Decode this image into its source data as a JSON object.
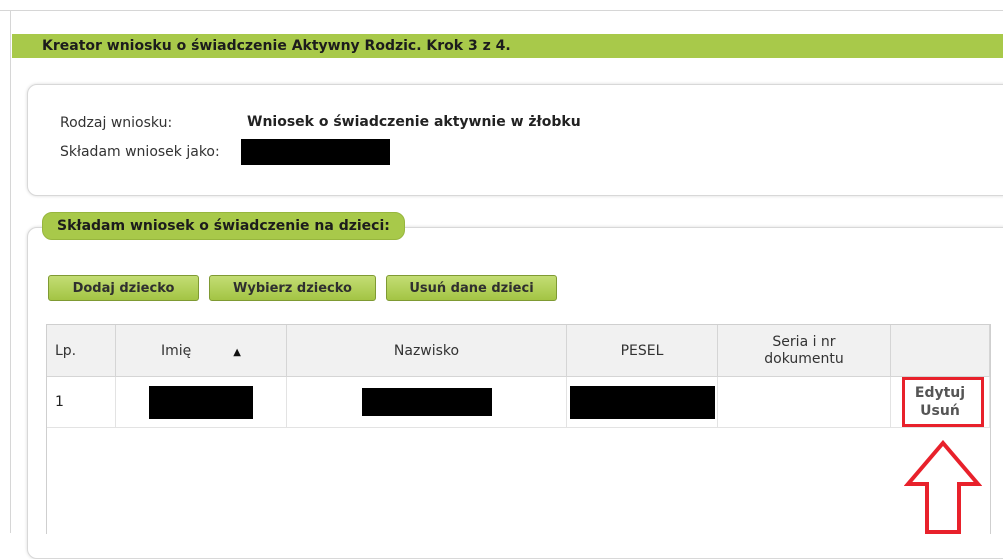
{
  "header": {
    "title": "Kreator wniosku o świadczenie Aktywny Rodzic. Krok 3 z 4."
  },
  "info": {
    "type_label": "Rodzaj wniosku:",
    "type_value": "Wniosek o świadczenie aktywnie w żłobku",
    "applicant_label": "Składam wniosek jako:"
  },
  "children_section": {
    "title": "Składam wniosek o świadczenie na dzieci:",
    "buttons": {
      "add": "Dodaj dziecko",
      "choose": "Wybierz dziecko",
      "remove": "Usuń dane dzieci"
    },
    "table": {
      "columns": {
        "lp": "Lp.",
        "imie": "Imię",
        "nazwisko": "Nazwisko",
        "pesel": "PESEL",
        "seria": "Seria i nr dokumentu",
        "actions": ""
      },
      "sort_indicator": "▲",
      "rows": [
        {
          "lp": "1",
          "edit": "Edytuj",
          "delete": "Usuń"
        }
      ]
    }
  },
  "colors": {
    "accent_green": "#a8c94a",
    "highlight_red": "#e8212b"
  }
}
